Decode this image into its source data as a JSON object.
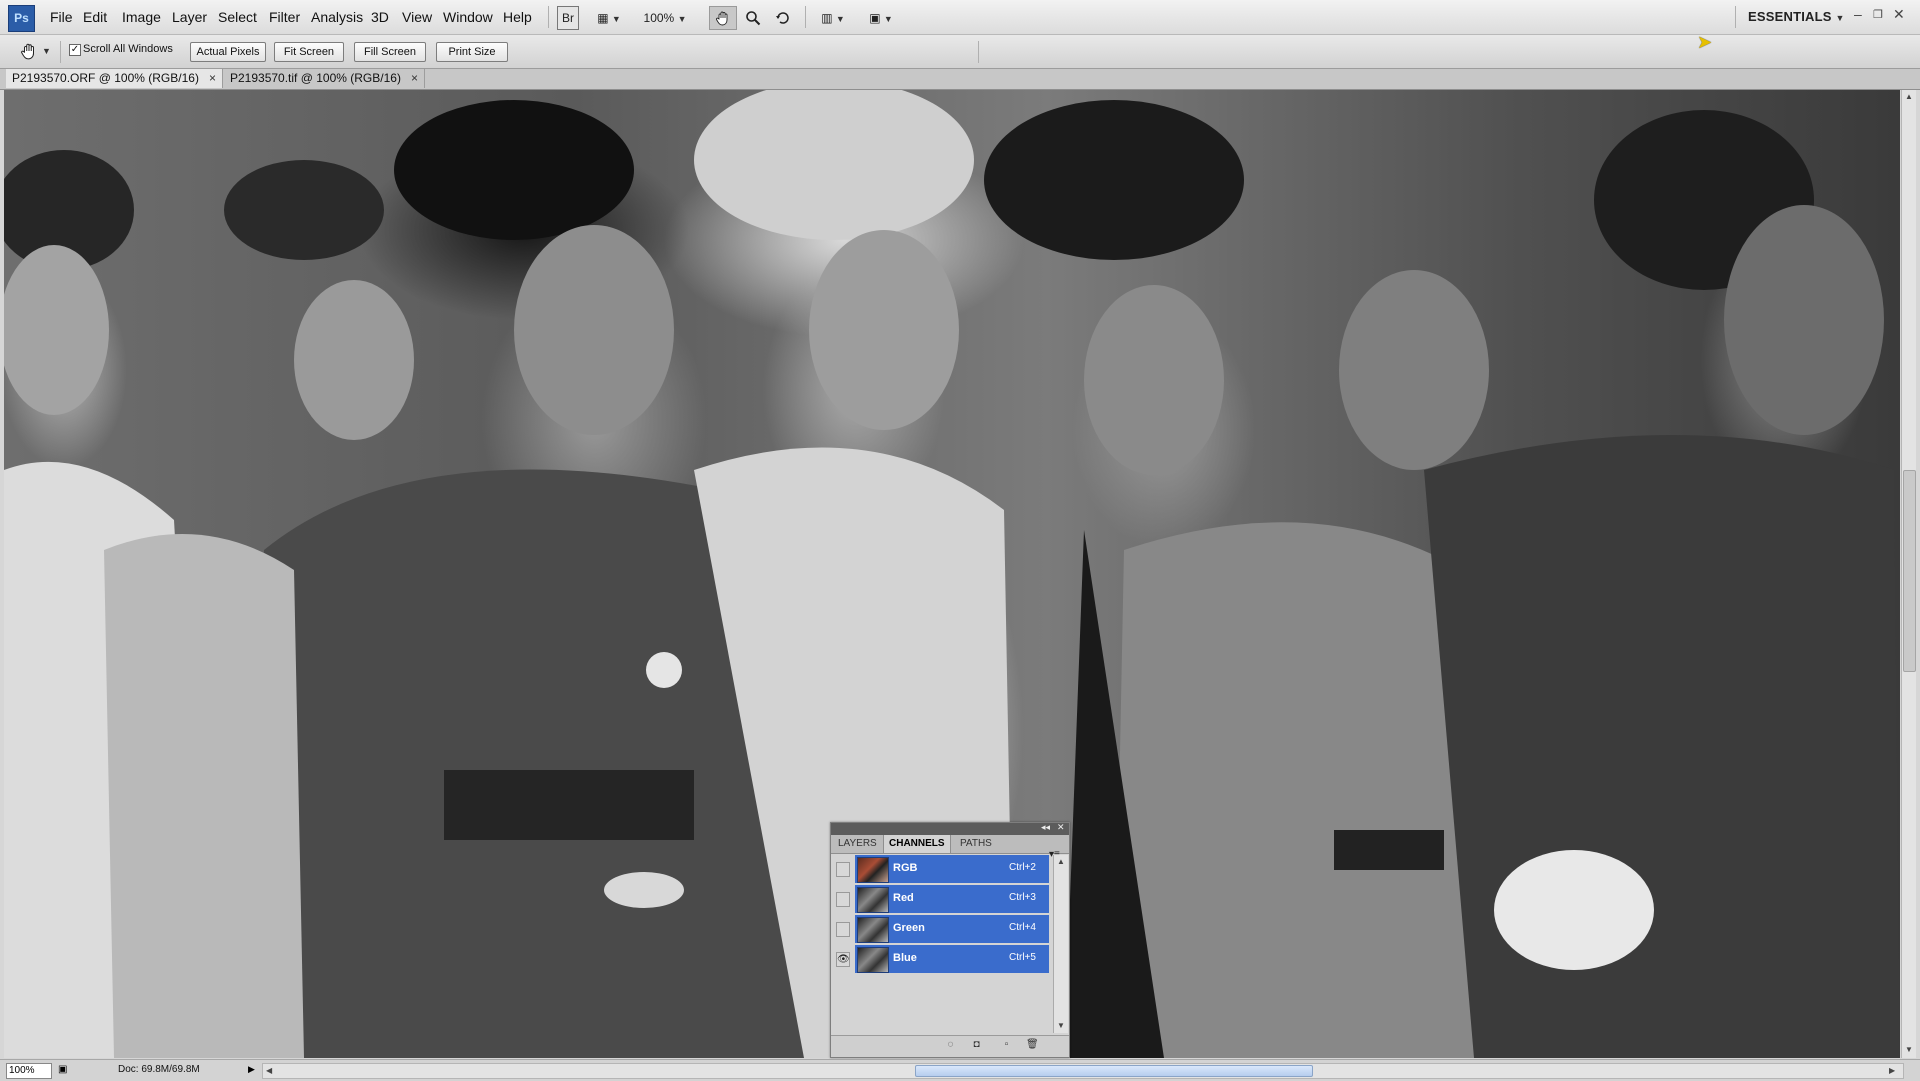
{
  "app": {
    "logo": "Ps",
    "menu": [
      "File",
      "Edit",
      "Image",
      "Layer",
      "Select",
      "Filter",
      "Analysis",
      "3D",
      "View",
      "Window",
      "Help"
    ],
    "zoom_level": "100%",
    "workspace": "ESSENTIALS",
    "bridge_label": "Br"
  },
  "options_bar": {
    "scroll_all_windows": "Scroll All Windows",
    "scroll_all_checked": "✓",
    "buttons": [
      "Actual Pixels",
      "Fit Screen",
      "Fill Screen",
      "Print Size"
    ]
  },
  "tabs": [
    {
      "label": "P2193570.ORF @ 100% (RGB/16)",
      "close": "×",
      "active": true
    },
    {
      "label": "P2193570.tif @ 100% (RGB/16)",
      "close": "×",
      "active": false
    }
  ],
  "status": {
    "zoom": "100%",
    "doc_info": "Doc: 69.8M/69.8M"
  },
  "channels_panel": {
    "tabs": [
      "LAYERS",
      "CHANNELS",
      "PATHS"
    ],
    "active_tab": "CHANNELS",
    "channels": [
      {
        "name": "RGB",
        "shortcut": "Ctrl+2",
        "visible": false
      },
      {
        "name": "Red",
        "shortcut": "Ctrl+3",
        "visible": false
      },
      {
        "name": "Green",
        "shortcut": "Ctrl+4",
        "visible": false
      },
      {
        "name": "Blue",
        "shortcut": "Ctrl+5",
        "visible": true
      }
    ],
    "selected_color": "#3a6ccc"
  },
  "icons": {
    "hand_tool": "hand-icon",
    "zoom_tool": "magnifier-icon",
    "rotate_tool": "rotate-view-icon",
    "eye": "👁"
  }
}
